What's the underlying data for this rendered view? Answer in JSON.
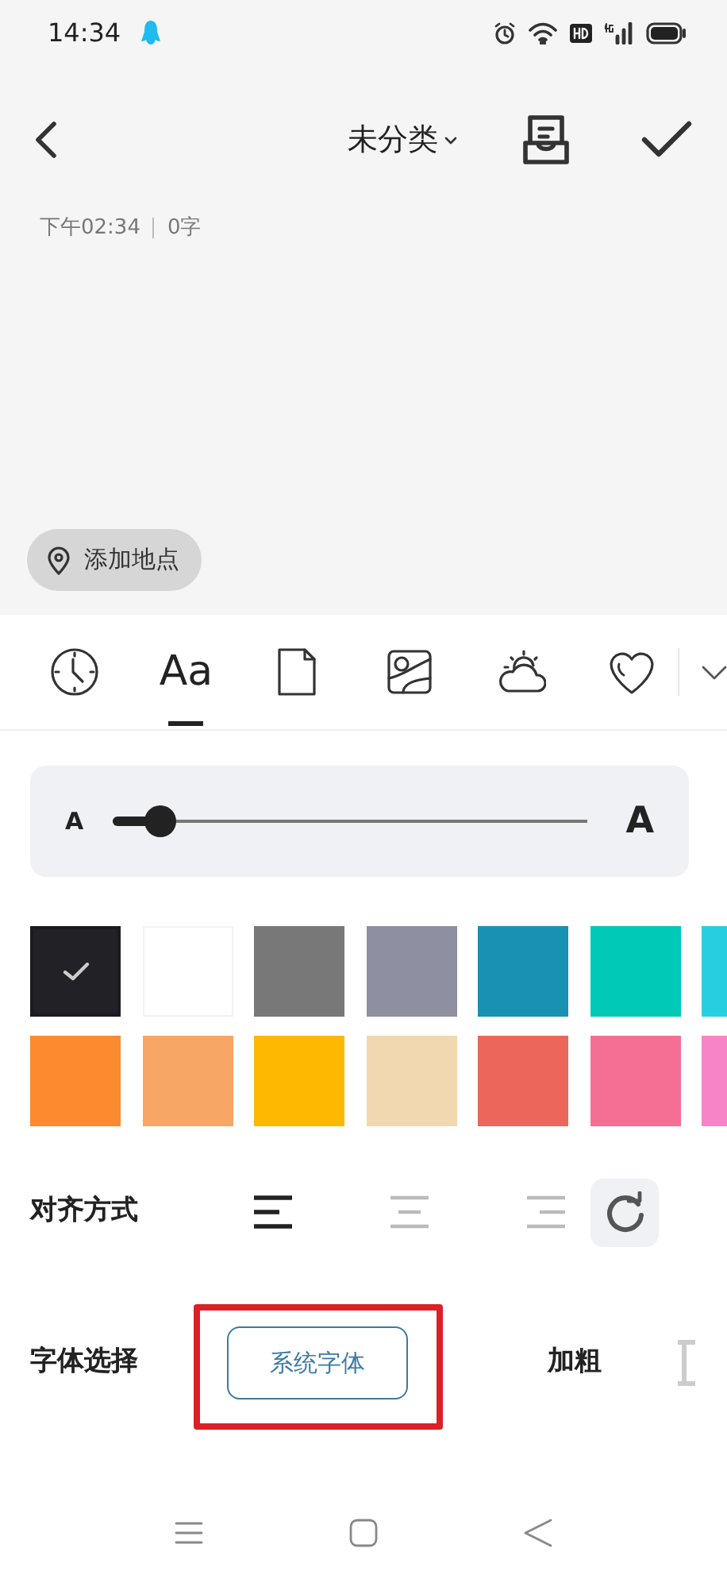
{
  "status_bar": {
    "time": "14:34"
  },
  "header": {
    "category": "未分类",
    "meta": "下午02:34",
    "word_count": "0字"
  },
  "location_button": {
    "label": "添加地点"
  },
  "toolbar_tabs": [
    {
      "kind": "clock",
      "selected": false
    },
    {
      "kind": "text",
      "label": "Aa",
      "selected": true
    },
    {
      "kind": "page",
      "selected": false
    },
    {
      "kind": "image",
      "selected": false
    },
    {
      "kind": "weather",
      "selected": false
    },
    {
      "kind": "heart",
      "selected": false
    }
  ],
  "font_size": {
    "small_label": "A",
    "large_label": "A",
    "level": 0.1
  },
  "colors": [
    {
      "color": "#222226",
      "selected": true
    },
    {
      "color": "#ffffff",
      "selected": false
    },
    {
      "color": "#787878",
      "selected": false
    },
    {
      "color": "#8e8fa0",
      "selected": false
    },
    {
      "color": "#1891b3",
      "selected": false
    },
    {
      "color": "#00c9b7",
      "selected": false
    },
    {
      "color": "#26cfe0",
      "selected": false
    },
    {
      "color": "#fd8a2e",
      "selected": false
    },
    {
      "color": "#f8a666",
      "selected": false
    },
    {
      "color": "#fdb902",
      "selected": false
    },
    {
      "color": "#f2d8b0",
      "selected": false
    },
    {
      "color": "#ec665c",
      "selected": false
    },
    {
      "color": "#f56f95",
      "selected": false
    },
    {
      "color": "#f784c6",
      "selected": false
    }
  ],
  "alignment": {
    "label": "对齐方式",
    "options": [
      {
        "kind": "left",
        "selected": true
      },
      {
        "kind": "center",
        "selected": false
      },
      {
        "kind": "right",
        "selected": false
      }
    ]
  },
  "font": {
    "label": "字体选择",
    "button": "系统字体",
    "bold_label": "加粗"
  }
}
